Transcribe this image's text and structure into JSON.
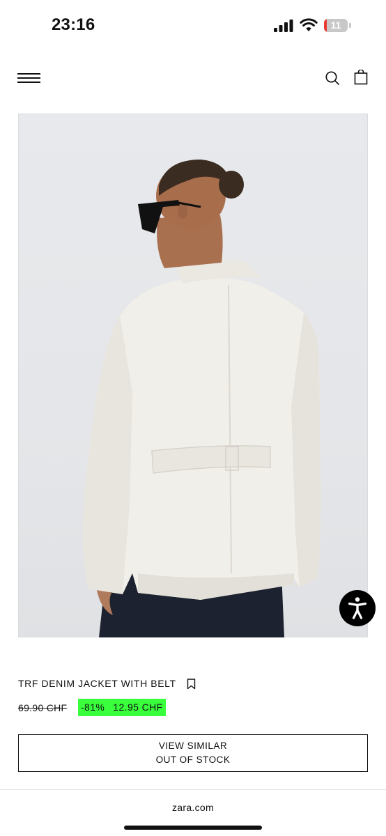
{
  "status_bar": {
    "time": "23:16",
    "battery_level": "11",
    "battery_fraction": 0.11,
    "battery_color": "#e63a32",
    "icons": [
      "signal-icon",
      "wifi-icon",
      "battery-icon"
    ]
  },
  "header": {
    "icons": [
      "menu-icon",
      "search-icon",
      "bag-icon"
    ]
  },
  "product": {
    "image_alt": "Model wearing a white denim jacket with belt, seen from the back",
    "name": "TRF DENIM JACKET WITH BELT",
    "old_price": "69.90 CHF",
    "discount": "-81%",
    "sale_price": "12.95 CHF",
    "sale_highlight_color": "#39ff3c"
  },
  "actions": {
    "view_similar": "VIEW SIMILAR",
    "out_of_stock": "OUT OF STOCK"
  },
  "accessibility": {
    "icon": "accessibility-icon"
  },
  "browser": {
    "url": "zara.com"
  }
}
